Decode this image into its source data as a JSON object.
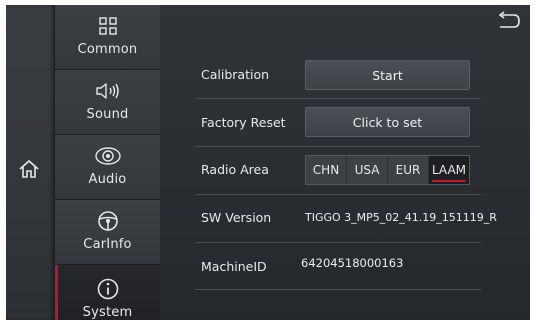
{
  "sidebar": {
    "items": [
      {
        "label": "Common",
        "icon": "grid-icon"
      },
      {
        "label": "Sound",
        "icon": "speaker-icon"
      },
      {
        "label": "Audio",
        "icon": "audio-effect-icon"
      },
      {
        "label": "CarInfo",
        "icon": "steering-wheel-icon"
      },
      {
        "label": "System",
        "icon": "info-icon",
        "active": true
      }
    ]
  },
  "settings": {
    "calibration": {
      "label": "Calibration",
      "button": "Start"
    },
    "factory_reset": {
      "label": "Factory Reset",
      "button": "Click to set"
    },
    "radio_area": {
      "label": "Radio Area",
      "options": [
        "CHN",
        "USA",
        "EUR",
        "LAAM"
      ],
      "selected": "LAAM"
    },
    "sw_version": {
      "label": "SW Version",
      "value": "TIGGO 3_MP5_02_41.19_151119_R"
    },
    "machine_id": {
      "label": "MachineID",
      "value": "64204518000163"
    }
  },
  "colors": {
    "accent": "#c0152a",
    "background": "#2c2f33",
    "text": "#e9eaec"
  }
}
